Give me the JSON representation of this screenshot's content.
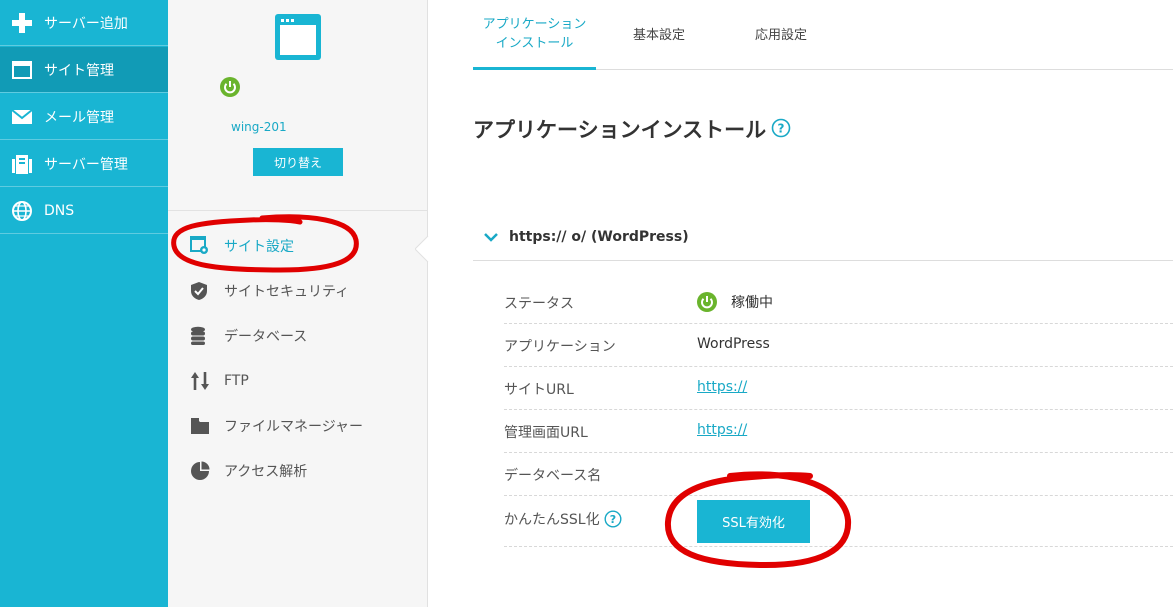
{
  "leftnav": {
    "items": [
      {
        "label": "サーバー追加",
        "icon": "plus-icon"
      },
      {
        "label": "サイト管理",
        "icon": "window-icon"
      },
      {
        "label": "メール管理",
        "icon": "mail-icon"
      },
      {
        "label": "サーバー管理",
        "icon": "server-icon"
      },
      {
        "label": "DNS",
        "icon": "globe-icon"
      }
    ],
    "active_index": 1
  },
  "server": {
    "name": "wing-201",
    "switch_label": "切り替え"
  },
  "sidebar": {
    "items": [
      {
        "label": "サイト設定",
        "icon": "site-settings-icon"
      },
      {
        "label": "サイトセキュリティ",
        "icon": "shield-icon"
      },
      {
        "label": "データベース",
        "icon": "database-icon"
      },
      {
        "label": "FTP",
        "icon": "transfer-arrows-icon"
      },
      {
        "label": "ファイルマネージャー",
        "icon": "folder-icon"
      },
      {
        "label": "アクセス解析",
        "icon": "pie-chart-icon"
      }
    ]
  },
  "tabs": [
    {
      "label_line1": "アプリケーション",
      "label_line2": "インストール"
    },
    {
      "label": "基本設定"
    },
    {
      "label": "応用設定"
    }
  ],
  "main": {
    "title": "アプリケーションインストール",
    "app_url": "https://                    o/ (WordPress)",
    "details": {
      "status_label": "ステータス",
      "status_value": "稼働中",
      "application_label": "アプリケーション",
      "application_value": "WordPress",
      "site_url_label": "サイトURL",
      "site_url_value": "https://",
      "admin_url_label": "管理画面URL",
      "admin_url_value": "https://",
      "db_name_label": "データベース名",
      "ssl_label": "かんたんSSL化",
      "ssl_button": "SSL有効化"
    }
  },
  "colors": {
    "brand": "#19b5d3",
    "brand_dark": "#119bb6",
    "link": "#19a9c6",
    "status_green": "#6ab42d",
    "annotation_red": "#e00000"
  }
}
